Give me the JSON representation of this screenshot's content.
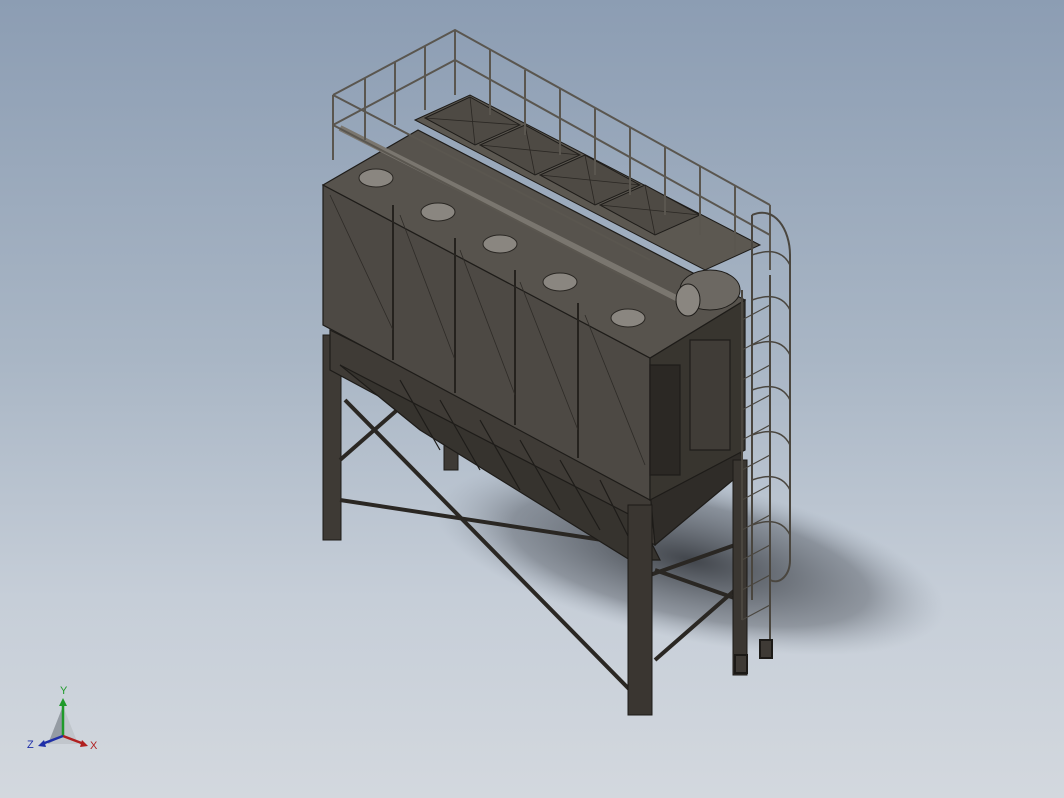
{
  "viewport": {
    "background_top": "#8c9db3",
    "background_bottom": "#d3d8de",
    "model_color": "#4a4640",
    "edge_color": "#1e1c19"
  },
  "triad": {
    "x_label": "X",
    "y_label": "Y",
    "z_label": "Z",
    "x_color": "#b02020",
    "y_color": "#1f9a2a",
    "z_color": "#1f2fa8"
  }
}
